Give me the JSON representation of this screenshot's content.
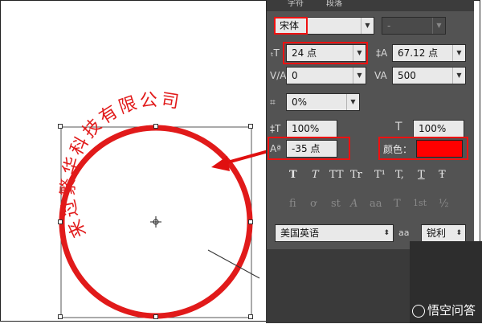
{
  "panel": {
    "tabs": [
      "字符",
      "段落"
    ],
    "font_family": "宋体",
    "font_style": "-",
    "font_size": "24 点",
    "leading": "67.12 点",
    "kerning": "0",
    "tracking": "500",
    "tsume": "0%",
    "vertical_scale": "100%",
    "horizontal_scale": "100%",
    "baseline_shift": "-35 点",
    "color_label": "颜色：",
    "color_value": "#ff0000",
    "style_buttons": [
      "T",
      "T",
      "TT",
      "Tr",
      "T¹",
      "T,",
      "T",
      "Ŧ"
    ],
    "opentype_buttons": [
      "fi",
      "ơ",
      "st",
      "A",
      "aa",
      "T",
      "1st",
      "½"
    ],
    "language": "美国英语",
    "aa_label": "a",
    "antialias": "锐利"
  },
  "stamp": {
    "text": "来过繁华科技有限公司",
    "color": "#e11a1a"
  },
  "watermark": "悟空问答"
}
